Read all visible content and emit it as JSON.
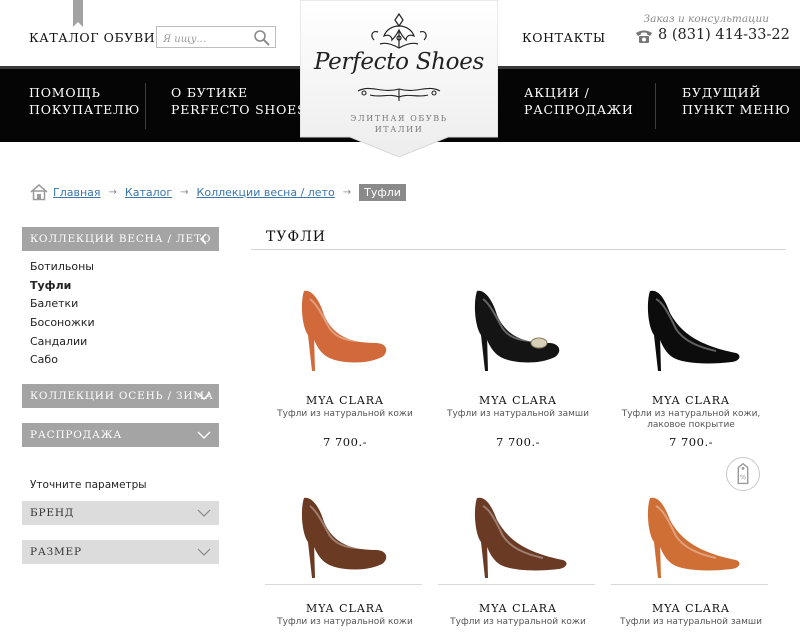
{
  "header": {
    "catalog_link": "КАТАЛОГ ОБУВИ",
    "search_placeholder": "Я ищу...",
    "contacts_link": "КОНТАКТЫ",
    "order_note": "Заказ и консультации",
    "phone": "8 (831) 414-33-22"
  },
  "logo": {
    "name": "Perfecto Shoes",
    "tagline": "ЭЛИТНАЯ ОБУВЬ\nИТАЛИИ"
  },
  "nav": [
    {
      "label": "ПОМОЩЬ\nПОКУПАТЕЛЮ"
    },
    {
      "label": "О БУТИКЕ\nPERFECTO SHOES"
    },
    {
      "label": "АКЦИИ /\nРАСПРОДАЖИ"
    },
    {
      "label": "БУДУЩИЙ\nПУНКТ МЕНЮ"
    }
  ],
  "breadcrumb": {
    "items": [
      "Главная",
      "Каталог",
      "Коллекции весна / лето"
    ],
    "separator": "→",
    "current": "Туфли"
  },
  "sidebar": {
    "spring_summer": "КОЛЛЕКЦИИ ВЕСНА / ЛЕТО",
    "subcategories": [
      "Ботильоны",
      "Туфли",
      "Балетки",
      "Босоножки",
      "Сандалии",
      "Сабо"
    ],
    "active_index": 1,
    "autumn_winter": "КОЛЛЕКЦИИ ОСЕНЬ / ЗИМА",
    "sale": "РАСПРОДАЖА",
    "refine_label": "Уточните параметры",
    "brand_filter": "БРЕНД",
    "size_filter": "РАЗМЕР"
  },
  "content": {
    "title": "ТУФЛИ"
  },
  "products": [
    {
      "brand": "MYA CLARA",
      "description": "Туфли из натуральной кожи",
      "price": "7 700.-",
      "color": "#d2693a",
      "style": "peep"
    },
    {
      "brand": "MYA CLARA",
      "description": "Туфли из натуральной замши",
      "price": "7 700.-",
      "color": "#141414",
      "style": "peep-buckle"
    },
    {
      "brand": "MYA CLARA",
      "description": "Туфли из натуральной кожи, лаковое покрытие",
      "price": "7 700.-",
      "color": "#0c0c0c",
      "style": "pointed"
    },
    {
      "brand": "MYA CLARA",
      "description": "Туфли из натуральной кожи",
      "price": "",
      "color": "#6b3a22",
      "style": "peep"
    },
    {
      "brand": "MYA CLARA",
      "description": "Туфли из натуральной кожи",
      "price": "",
      "color": "#6a3a24",
      "style": "pointed"
    },
    {
      "brand": "MYA CLARA",
      "description": "Туфли из натуральной замши",
      "price": "",
      "color": "#cf6f36",
      "style": "pointed"
    }
  ],
  "sale_icon": "sale-tag-icon"
}
